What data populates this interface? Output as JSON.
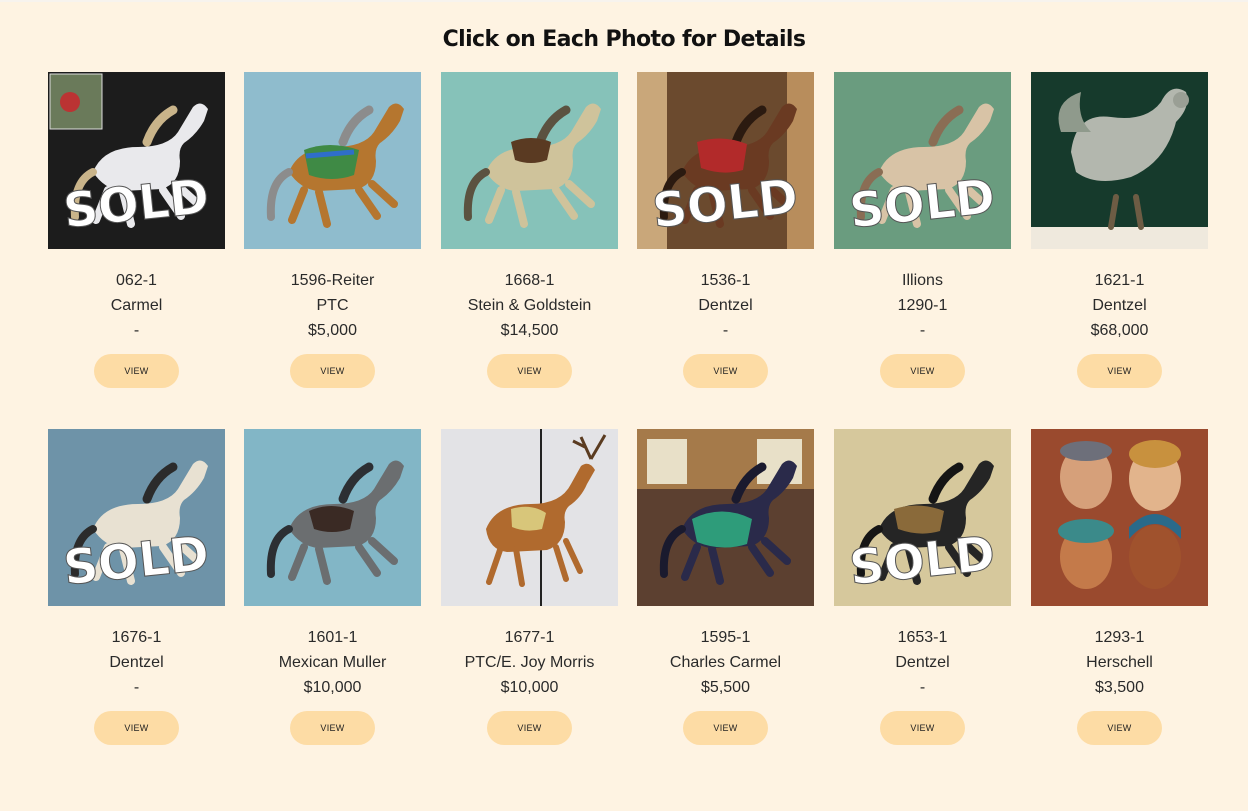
{
  "page": {
    "title": "Click on Each Photo for Details"
  },
  "colors": {
    "background": "#fef3e2",
    "button": "#fddca5"
  },
  "sold_text": "SOLD",
  "items": [
    {
      "line1": "062-1",
      "line2": "Carmel",
      "line3": "-",
      "sold": true,
      "button": "VIEW",
      "bg": "#1c1c1c",
      "subject": "white-horse-photo"
    },
    {
      "line1": "1596-Reiter",
      "line2": "PTC",
      "line3": "$5,000",
      "sold": false,
      "button": "VIEW",
      "bg": "#8fbccd",
      "subject": "brown-horse-photo"
    },
    {
      "line1": "1668-1",
      "line2": "Stein & Goldstein",
      "line3": "$14,500",
      "sold": false,
      "button": "VIEW",
      "bg": "#86c2b9",
      "subject": "dapple-horse-photo"
    },
    {
      "line1": "1536-1",
      "line2": "Dentzel",
      "line3": "-",
      "sold": true,
      "button": "VIEW",
      "bg": "#6b4a2e",
      "subject": "horse-indoor-photo"
    },
    {
      "line1": "Illions",
      "line2": "1290-1",
      "line3": "-",
      "sold": true,
      "button": "VIEW",
      "bg": "#6a9c7f",
      "subject": "tan-horse-photo"
    },
    {
      "line1": "1621-1",
      "line2": "Dentzel",
      "line3": "$68,000",
      "sold": false,
      "button": "VIEW",
      "bg": "#163a2c",
      "subject": "rooster-photo"
    },
    {
      "line1": "1676-1",
      "line2": "Dentzel",
      "line3": "-",
      "sold": true,
      "button": "VIEW",
      "bg": "#6e93a8",
      "subject": "cream-horse-photo"
    },
    {
      "line1": "1601-1",
      "line2": "Mexican Muller",
      "line3": "$10,000",
      "sold": false,
      "button": "VIEW",
      "bg": "#82b6c6",
      "subject": "gray-horse-photo"
    },
    {
      "line1": "1677-1",
      "line2": "PTC/E. Joy Morris",
      "line3": "$10,000",
      "sold": false,
      "button": "VIEW",
      "bg": "#e3e3e6",
      "subject": "deer-photo"
    },
    {
      "line1": "1595-1",
      "line2": "Charles Carmel",
      "line3": "$5,500",
      "sold": false,
      "button": "VIEW",
      "bg": "#5c4030",
      "subject": "painted-horse-indoor-photo"
    },
    {
      "line1": "1653-1",
      "line2": "Dentzel",
      "line3": "-",
      "sold": true,
      "button": "VIEW",
      "bg": "#d6c89c",
      "subject": "black-horse-photo"
    },
    {
      "line1": "1293-1",
      "line2": "Herschell",
      "line3": "$3,500",
      "sold": false,
      "button": "VIEW",
      "bg": "#9a4a2e",
      "subject": "carved-faces-photo"
    }
  ]
}
